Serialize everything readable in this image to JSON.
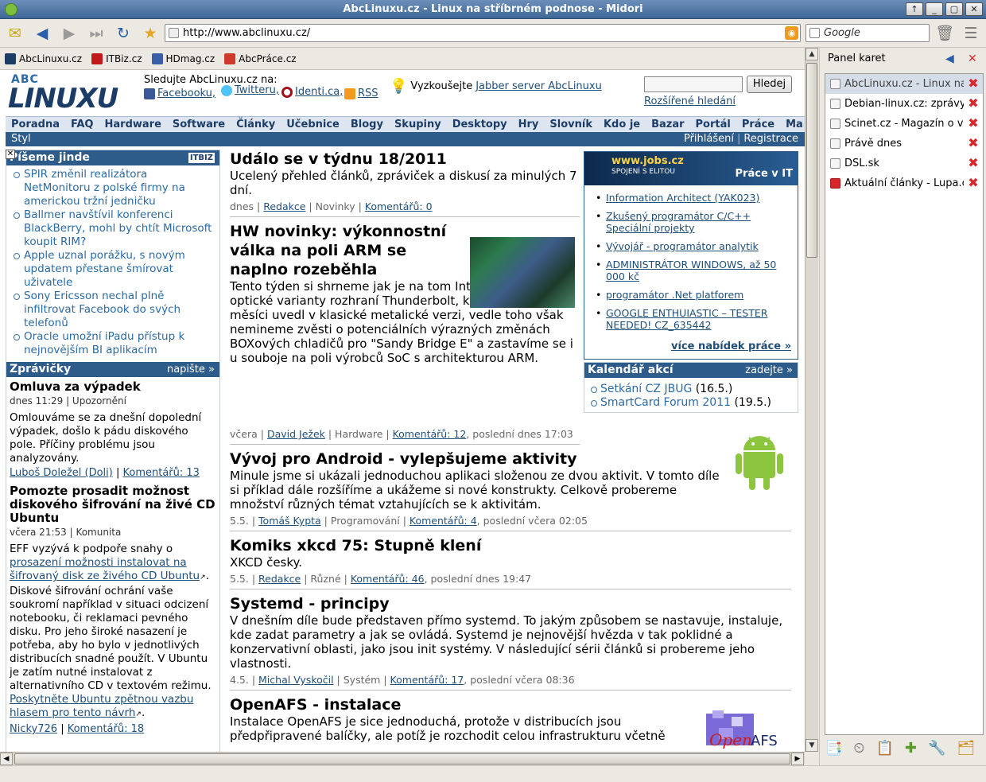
{
  "window": {
    "title": "AbcLinuxu.cz - Linux na stříbrném podnose - Midori"
  },
  "toolbar": {
    "url": "http://www.abclinuxu.cz/",
    "search_placeholder": "Google"
  },
  "bookmarks": [
    "AbcLinuxu.cz",
    "ITBiz.cz",
    "HDmag.cz",
    "AbcPráce.cz"
  ],
  "header": {
    "follow": "Sledujte AbcLinuxu.cz na:",
    "facebook": "Facebooku,",
    "twitter": "Twitteru,",
    "identica": "Identi.ca,",
    "rss": "RSS",
    "jabber_prefix": "Vyzkoušejte",
    "jabber_link": "Jabber server AbcLinuxu",
    "search_button": "Hledej",
    "advanced_search": "Rozšířené hledání"
  },
  "nav": [
    "Poradna",
    "FAQ",
    "Hardware",
    "Software",
    "Články",
    "Učebnice",
    "Blogy",
    "Skupiny",
    "Desktopy",
    "Hry",
    "Slovník",
    "Kdo je",
    "Bazar",
    "Portál",
    "Práce",
    "Ma"
  ],
  "subnav": {
    "style": "Styl",
    "login": "Přihlášení",
    "register": "Registrace"
  },
  "left": {
    "pisme_title": "Píšeme jinde",
    "pisme_tag": "ITBIZ",
    "pisme_items": [
      "SPIR změnil realizátora NetMonitoru z polské firmy na americkou tržní jedničku",
      "Ballmer navštívil konferenci BlackBerry, mohl by chtít Microsoft koupit RIM?",
      "Apple uznal porážku, s novým updatem přestane šmírovat uživatele",
      "Sony Ericsson nechal plně infiltrovat Facebook do svých telefonů",
      "Oracle umožní iPadu přístup k nejnovějším BI aplikacím"
    ],
    "zpravicky_title": "Zprávičky",
    "zpravicky_action": "napište »",
    "news": [
      {
        "title": "Omluva za výpadek",
        "meta": "dnes 11:29 | Upozornění",
        "text": "Omlouváme se za dnešní dopolední výpadek, došlo k pádu diskového pole. Příčiny problému jsou analyzovány.",
        "author": "Luboš Doležel (Doli)",
        "comments": "Komentářů: 13"
      },
      {
        "title": "Pomozte prosadit možnost diskového šifrování na živé CD Ubuntu",
        "meta": "včera 21:53 | Komunita",
        "text_a": "EFF vyzývá k podpoře snahy o",
        "link_a": "prosazení možnosti instalovat na šifrovaný disk ze živého CD Ubuntu",
        "text_b": "Diskové šifrování ochrání vaše soukromí například v situaci odcizení notebooku, či reklamaci pevného disku. Pro jeho široké nasazení je potřeba, aby ho bylo v jednotlivých distribucích snadné použít. V Ubuntu je zatím nutné instalovat z alternativního CD v textovém režimu.",
        "link_b": "Poskytněte Ubuntu zpětnou vazbu hlasem pro tento návrh",
        "author": "Nicky726",
        "comments": "Komentářů: 18"
      }
    ]
  },
  "articles": [
    {
      "title": "Událo se v týdnu 18/2011",
      "text": "Ucelený přehled článků, zpráviček a diskusí za minulých 7 dní.",
      "date": "dnes",
      "author": "Redakce",
      "section": "Novinky",
      "comments": "Komentářů: 0",
      "last": ""
    },
    {
      "title": "HW novinky: výkonnostní válka na poli ARM se naplno rozeběhla",
      "text": "Tento týden si shrneme jak je na tom Intel s vývojem optické varianty rozhraní Thunderbolt, které před pár měsíci uvedl v klasické metalické verzi, vedle toho však nemineme zvěsti o potenciálních výrazných změnách BOXových chladičů pro \"Sandy Bridge E\" a zastavíme se i u souboje na poli výrobců SoC s architekturou ARM.",
      "date": "včera",
      "author": "David Ježek",
      "section": "Hardware",
      "comments": "Komentářů: 12",
      "last": ", poslední dnes 17:03"
    },
    {
      "title": "Vývoj pro Android - vylepšujeme aktivity",
      "text": "Minule jsme si ukázali jednoduchou aplikaci složenou ze dvou aktivit. V tomto díle si příklad dále rozšíříme a ukážeme si nové konstrukty. Celkově probereme množství různých témat vztahujících se k aktivitám.",
      "date": "5.5.",
      "author": "Tomáš Kypta",
      "section": "Programování",
      "comments": "Komentářů: 4",
      "last": ", poslední včera 02:05"
    },
    {
      "title": "Komiks xkcd 75: Stupně klení",
      "text": "XKCD česky.",
      "date": "5.5.",
      "author": "Redakce",
      "section": "Různé",
      "comments": "Komentářů: 46",
      "last": ", poslední dnes 19:47"
    },
    {
      "title": "Systemd - principy",
      "text": "V dnešním díle bude představen přímo systemd. To jakým způsobem se nastavuje, instaluje, kde zadat parametry a jak se ovládá. Systemd je nejnovější hvězda v tak poklidné a konzervativní oblasti, jako jsou init systémy. V následující sérii článků si probereme jeho vlastnosti.",
      "date": "4.5.",
      "author": "Michal Vyskočil",
      "section": "Systém",
      "comments": "Komentářů: 17",
      "last": ", poslední včera 08:36"
    },
    {
      "title": "OpenAFS - instalace",
      "text": "Instalace OpenAFS je sice jednoduchá, protože v distribucích jsou předpřipravené balíčky, ale potíž je rozchodit celou infrastrukturu včetně",
      "date": "",
      "author": "",
      "section": "",
      "comments": "",
      "last": ""
    }
  ],
  "jobs": {
    "brand": "www.jobs.cz",
    "brand_sub": "SPOJENÍ S ELITOU",
    "title": "Práce v IT",
    "items": [
      "Information Architect (YAK023)",
      "Zkušený programátor C/C++ Speciální projekty",
      "Vývojář - programátor analytik",
      "ADMINISTRÁTOR WINDOWS, až 50 000 kč",
      "programátor .Net platforem",
      "GOOGLE ENTHUIASTIC – TESTER NEEDED! CZ_635442"
    ],
    "more": "více nabídek práce »"
  },
  "calendar": {
    "title": "Kalendář akcí",
    "action": "zadejte »",
    "items": [
      {
        "name": "Setkání CZ JBUG",
        "date": "(16.5.)"
      },
      {
        "name": "SmartCard Forum 2011",
        "date": "(19.5.)"
      }
    ]
  },
  "panel": {
    "title": "Panel karet",
    "tabs": [
      "AbcLinuxu.cz - Linux na stříbrném podnose",
      "Debian-linux.cz: zprávy",
      "Scinet.cz - Magazín o vědě",
      "Právě dnes",
      "DSL.sk",
      "Aktuální články - Lupa.cz"
    ],
    "selected": 0
  },
  "colors": {
    "header_blue": "#2d5b8a",
    "link": "#2a6aa6",
    "close_red": "#d8262b"
  }
}
